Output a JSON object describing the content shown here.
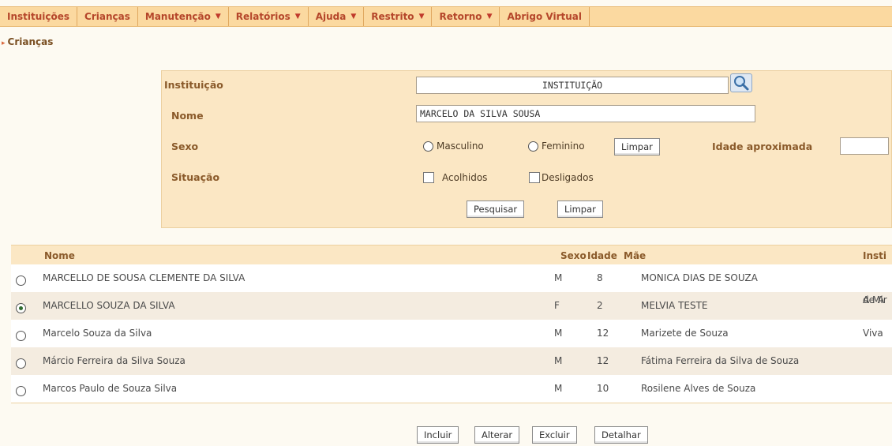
{
  "menu": {
    "items": [
      {
        "label": "Instituições",
        "dropdown": false
      },
      {
        "label": "Crianças",
        "dropdown": false
      },
      {
        "label": "Manutenção",
        "dropdown": true
      },
      {
        "label": "Relatórios",
        "dropdown": true
      },
      {
        "label": "Ajuda",
        "dropdown": true
      },
      {
        "label": "Restrito",
        "dropdown": true
      },
      {
        "label": "Retorno",
        "dropdown": true
      },
      {
        "label": "Abrigo Virtual",
        "dropdown": false
      }
    ],
    "arrow": "▼"
  },
  "breadcrumb": {
    "bullet": "▸",
    "label": "Crianças"
  },
  "search": {
    "instituicao_label": "Instituição",
    "instituicao_value": "INSTITUIÇÃO",
    "nome_label": "Nome",
    "nome_value": "MARCELO DA SILVA SOUSA",
    "sexo_label": "Sexo",
    "masculino": "Masculino",
    "feminino": "Feminino",
    "limpar_sexo": "Limpar",
    "idade_label": "Idade aproximada",
    "idade_value": "",
    "situacao_label": "Situação",
    "acolhidos": "Acolhidos",
    "desligados": "Desligados",
    "pesquisar": "Pesquisar",
    "limpar": "Limpar"
  },
  "table": {
    "headers": {
      "nome": "Nome",
      "sexo": "Sexo",
      "idade": "Idade",
      "mae": "Mãe",
      "inst": "Insti"
    },
    "rows": [
      {
        "selected": false,
        "nome": "MARCELLO DE SOUSA CLEMENTE DA SILVA",
        "sexo": "M",
        "idade": "8",
        "mae": "MONICA DIAS DE SOUZA",
        "inst1": "",
        "inst2": ""
      },
      {
        "selected": true,
        "nome": "MARCELLO SOUZA DA SILVA",
        "sexo": "F",
        "idade": "2",
        "mae": "MELVIA TESTE",
        "inst1": "A Mir",
        "inst2": "de A"
      },
      {
        "selected": false,
        "nome": "Marcelo Souza da Silva",
        "sexo": "M",
        "idade": "12",
        "mae": "Marizete de Souza",
        "inst1": "Viva",
        "inst2": ""
      },
      {
        "selected": false,
        "nome": "Márcio Ferreira da Silva Souza",
        "sexo": "M",
        "idade": "12",
        "mae": "Fátima Ferreira da Silva de Souza",
        "inst1": "",
        "inst2": ""
      },
      {
        "selected": false,
        "nome": "Marcos Paulo de Souza Silva",
        "sexo": "M",
        "idade": "10",
        "mae": "Rosilene Alves de Souza",
        "inst1": "",
        "inst2": ""
      }
    ]
  },
  "actions": {
    "incluir": "Incluir",
    "alterar": "Alterar",
    "excluir": "Excluir",
    "detalhar": "Detalhar"
  },
  "colors": {
    "menu_bg": "#fbd9a0",
    "menu_text": "#b5462a",
    "panel_bg": "#fbe7c4",
    "label_text": "#8a5a2a"
  }
}
